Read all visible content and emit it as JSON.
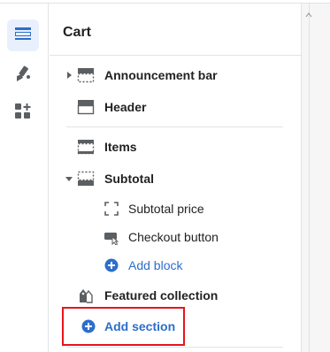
{
  "panel": {
    "title": "Cart"
  },
  "rail": {
    "items": [
      {
        "icon": "sections-icon",
        "active": true
      },
      {
        "icon": "theme-settings-brush-icon",
        "active": false
      },
      {
        "icon": "app-blocks-icon",
        "active": false
      }
    ]
  },
  "sections": {
    "announcement_bar": "Announcement bar",
    "header": "Header",
    "items": "Items",
    "subtotal": "Subtotal",
    "subtotal_price": "Subtotal price",
    "checkout_button": "Checkout button",
    "add_block": "Add block",
    "featured_collection": "Featured collection",
    "add_section": "Add section"
  },
  "colors": {
    "accent": "#2c6ecb",
    "highlight_box": "#e8141b",
    "rail_active_bg": "#e9f0fd",
    "text": "#202223",
    "icon": "#5c5f62"
  }
}
